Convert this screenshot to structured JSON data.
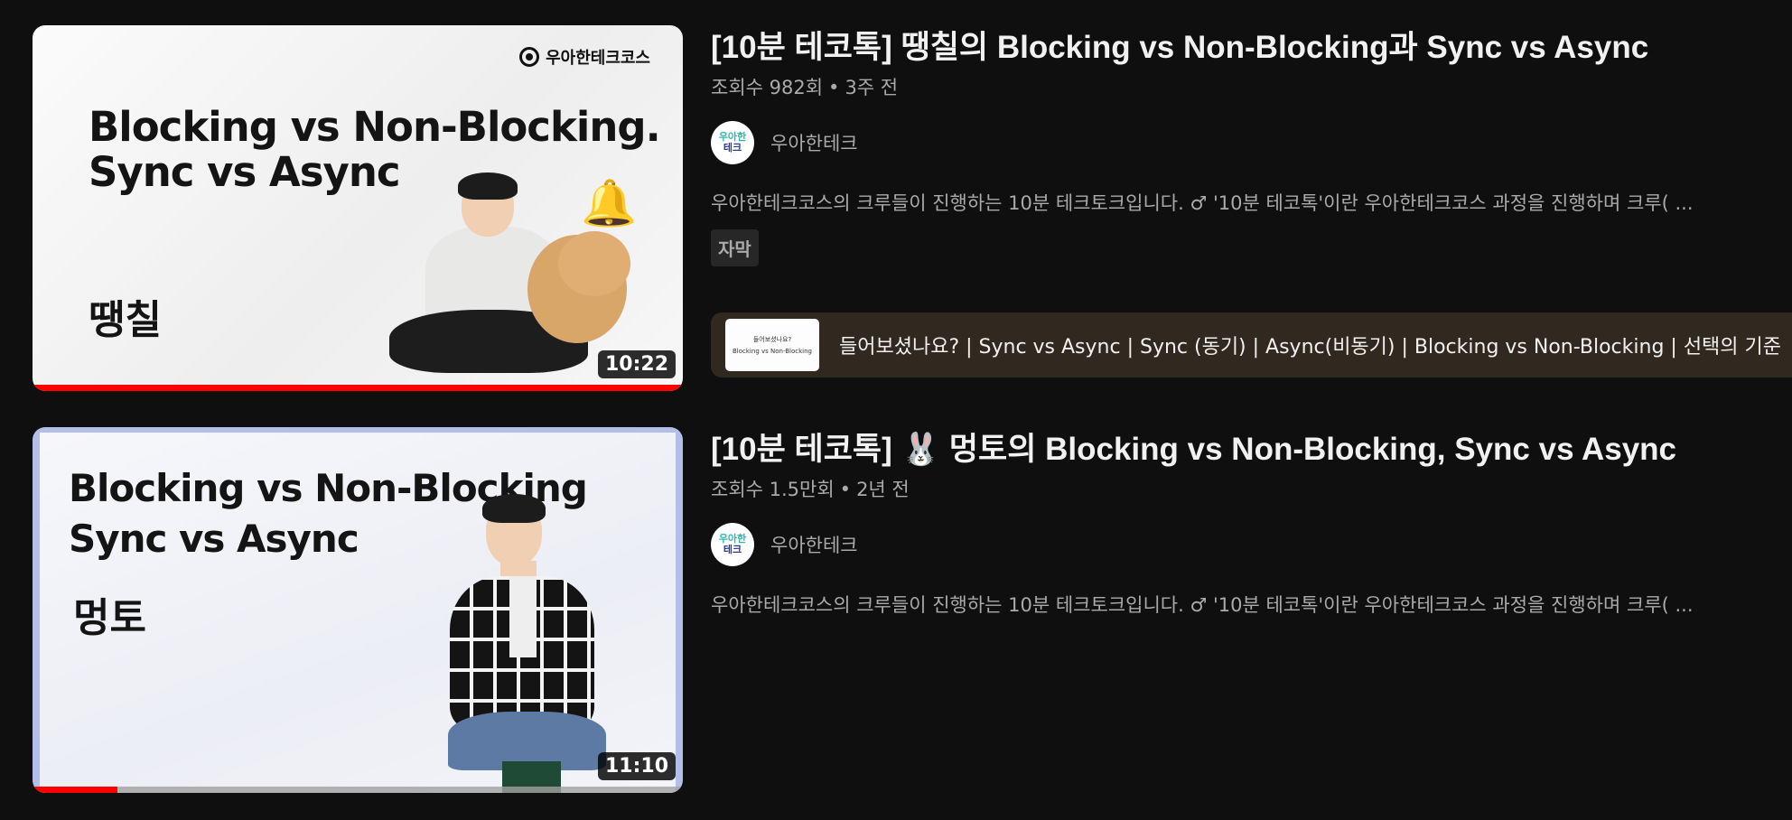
{
  "videos": [
    {
      "thumbnail": {
        "brand": "우아한테크코스",
        "title": "Blocking vs Non-Blocking.\nSync vs Async",
        "name": "땡칠",
        "duration": "10:22",
        "watched_fraction": 1.0
      },
      "title": "[10분 테코톡] 땡칠의 Blocking vs Non-Blocking과 Sync vs Async",
      "views": "조회수 982회",
      "age": "3주 전",
      "channel": {
        "name": "우아한테크",
        "avatar_line1": "우아한",
        "avatar_line2": "테크"
      },
      "description": "우아한테크코스의 크루들이 진행하는 10분 테크토크입니다. ♂ '10분 테코톡'이란 우아한테크코스 과정을 진행하며 크루( ...",
      "badge": "자막",
      "chapter": {
        "thumb_line1": "들어보셨나요?",
        "thumb_line2": "Blocking vs Non-Blocking",
        "text": "들어보셨나요? | Sync vs Async | Sync (동기) | Async(비동기) | Blocking vs Non-Blocking | 선택의 기준"
      }
    },
    {
      "thumbnail": {
        "title": "Blocking vs Non-Blocking\nSync vs Async",
        "name": "멍토",
        "duration": "11:10",
        "watched_fraction": 0.13
      },
      "title": "[10분 테코톡] 🐰 멍토의 Blocking vs Non-Blocking, Sync vs Async",
      "views": "조회수 1.5만회",
      "age": "2년 전",
      "channel": {
        "name": "우아한테크",
        "avatar_line1": "우아한",
        "avatar_line2": "테크"
      },
      "description": "우아한테크코스의 크루들이 진행하는 10분 테크토크입니다. ♂ '10분 테코톡'이란 우아한테크코스 과정을 진행하며 크루( ..."
    }
  ],
  "colors": {
    "background": "#0f0f0f",
    "progress": "#ff0000",
    "secondary_text": "#aaaaaa",
    "chapter_bg": "#31291f"
  }
}
